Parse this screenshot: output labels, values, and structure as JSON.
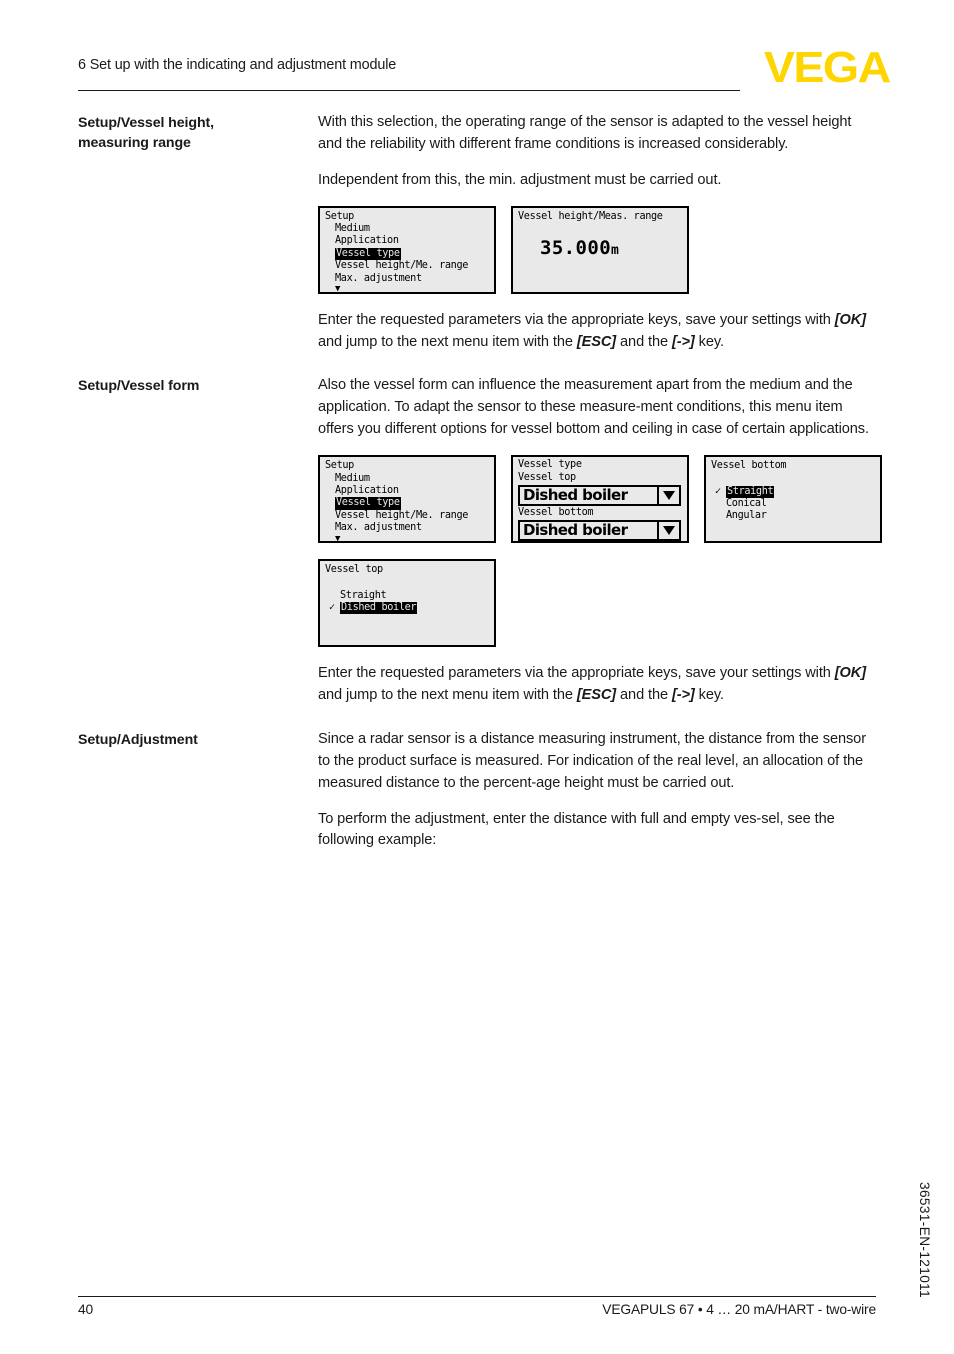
{
  "header": {
    "chapter_title": "6 Set up with the indicating and adjustment module",
    "logo_text": "VEGA",
    "logo_color": "#ffd500"
  },
  "sections": [
    {
      "label": "Setup/Vessel height,\nmeasuring range",
      "label_line1": "Setup/Vessel height,",
      "label_line2": "measuring range",
      "paragraphs": [
        "With this selection, the operating range of the sensor is adapted to the vessel height and the reliability with different frame conditions is increased considerably.",
        "Independent from this, the min. adjustment must be carried out."
      ],
      "note_parts": {
        "p1": "Enter the requested parameters via the appropriate keys, save your settings with ",
        "k1": "[OK]",
        "p2": " and jump to the next menu item with the ",
        "k2": "[ESC]",
        "p3": " and the ",
        "k3": "[->]",
        "p4": " key."
      }
    },
    {
      "label_line1": "Setup/Vessel form",
      "paragraphs": [
        "Also the vessel form can influence the measurement apart from the medium and the application. To adapt the sensor to these measure-ment conditions, this menu item offers you different options for vessel bottom and ceiling in case of certain applications."
      ]
    },
    {
      "label_line1": "Setup/Adjustment",
      "paragraphs": [
        "Since a radar sensor is a distance measuring instrument, the distance from the sensor to the product surface is measured. For indication of the real level, an allocation of the measured distance to the percent-age height must be carried out.",
        "To perform the adjustment, enter the distance with full and empty ves-sel, see the following example:"
      ]
    }
  ],
  "lcd_screens": {
    "setup_menu": {
      "title": "Setup",
      "items": [
        "Medium",
        "Application",
        "Vessel type",
        "Vessel height/Me. range",
        "Max. adjustment"
      ],
      "highlighted": "Vessel type",
      "scroll_arrow": "▼"
    },
    "vessel_height": {
      "title": "Vessel height/Meas. range",
      "value": "35.000",
      "unit": "m"
    },
    "vessel_type_form": {
      "title": "Vessel type",
      "top_label": "Vessel top",
      "top_value": "Dished boiler",
      "bottom_label": "Vessel bottom",
      "bottom_value": "Dished boiler",
      "dropdown_icon": "chevron-down"
    },
    "vessel_bottom_list": {
      "title": "Vessel bottom",
      "options": [
        "Straight",
        "Conical",
        "Angular"
      ],
      "selected": "Straight",
      "check": "✓"
    },
    "vessel_top_list": {
      "title": "Vessel top",
      "options": [
        "Straight",
        "Dished boiler"
      ],
      "selected": "Dished boiler",
      "check": "✓"
    }
  },
  "footer": {
    "page_number": "40",
    "product_line": "VEGAPULS 67 • 4 … 20 mA/HART - two-wire",
    "document_id": "36531-EN-121011"
  }
}
